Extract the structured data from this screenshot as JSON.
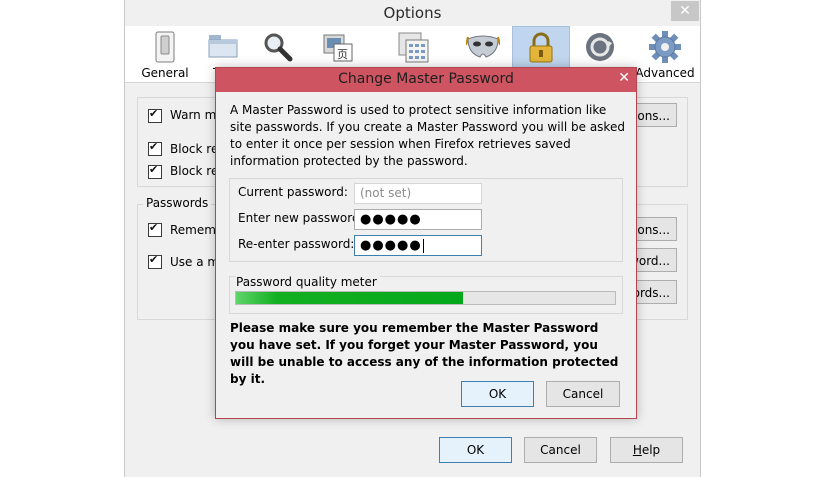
{
  "options_window": {
    "title": "Options",
    "close_glyph": "✕",
    "panes": [
      {
        "label": "General",
        "icon": "general-switch-icon"
      },
      {
        "label": "T",
        "icon": "tabs-icon"
      },
      {
        "label": "",
        "icon": "search-magnifier-icon"
      },
      {
        "label": "",
        "icon": "content-icon"
      },
      {
        "label": "",
        "icon": "applications-icon"
      },
      {
        "label": "",
        "icon": "privacy-mask-icon"
      },
      {
        "label": "",
        "icon": "security-lock-icon",
        "selected": true
      },
      {
        "label": "",
        "icon": "sync-icon"
      },
      {
        "label": "Advanced",
        "icon": "advanced-gear-icon"
      }
    ],
    "general_checks": [
      "Warn me",
      "Block rep",
      "Block rep"
    ],
    "passwords_group_label": "Passwords",
    "password_checks": [
      "Remember",
      "Use a ma"
    ],
    "right_buttons": [
      "tions...",
      "tions...",
      "word...",
      "words..."
    ],
    "footer": {
      "ok": "OK",
      "cancel": "Cancel",
      "help": "Help",
      "help_accel": "H",
      "help_rest": "elp"
    }
  },
  "dialog": {
    "title": "Change Master Password",
    "close_glyph": "✕",
    "intro": "A Master Password is used to protect sensitive information like site passwords. If you create a Master Password you will be asked to enter it once per session when Firefox retrieves saved information protected by the password.",
    "fields": {
      "current_label": "Current password:",
      "current_value": "(not set)",
      "new_label": "Enter new password:",
      "new_value": "●●●●●",
      "reenter_label": "Re-enter password:",
      "reenter_value": "●●●●●"
    },
    "meter": {
      "label": "Password quality meter",
      "value_percent": 60
    },
    "warning": "Please make sure you remember the Master Password you have set. If you forget your Master Password, you will be unable to access any of the information protected by it.",
    "ok_label": "OK",
    "cancel_label": "Cancel"
  }
}
